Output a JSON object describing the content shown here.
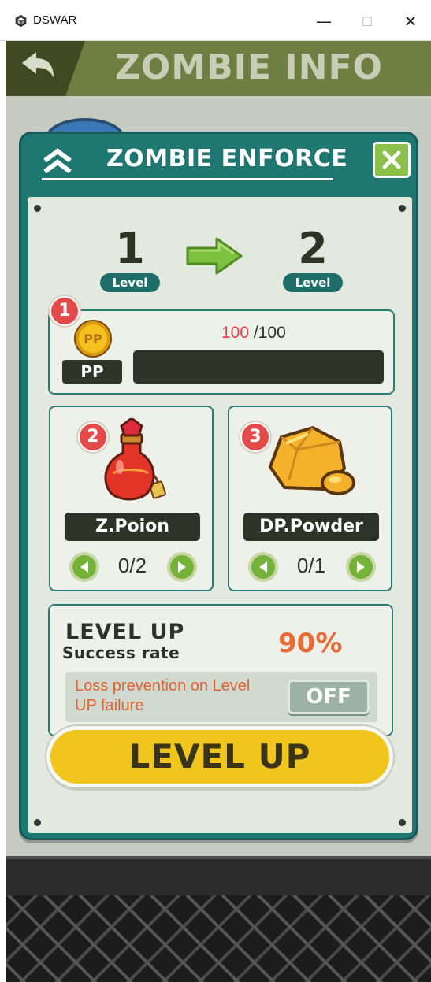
{
  "window": {
    "title": "DSWAR",
    "minimize": "—",
    "maximize": "☐",
    "close": "✕"
  },
  "header": {
    "title": "ZOMBIE INFO"
  },
  "dialog": {
    "title": "ZOMBIE ENFORCE",
    "level_from": {
      "number": "1",
      "label": "Level"
    },
    "level_to": {
      "number": "2",
      "label": "Level"
    },
    "pp_section": {
      "badge": "1",
      "label": "PP",
      "current": "100",
      "max": " /100",
      "fill_fraction": 1.0
    },
    "items": [
      {
        "badge": "2",
        "name": "Z.Poion",
        "count": "0/2"
      },
      {
        "badge": "3",
        "name": "DP.Powder",
        "count": "0/1"
      }
    ],
    "success": {
      "title": "LEVEL UP",
      "subtitle": "Success rate",
      "rate": "90%",
      "loss_prevention_text": "Loss prevention on Level UP failure",
      "toggle_label": "OFF"
    },
    "level_up_button": "LEVEL UP"
  },
  "colors": {
    "dialog_teal": "#1f7772",
    "close_green": "#8bc04a",
    "badge_red": "#e54a4a",
    "rate_orange": "#ea6a34",
    "button_yellow": "#f0c51d"
  }
}
